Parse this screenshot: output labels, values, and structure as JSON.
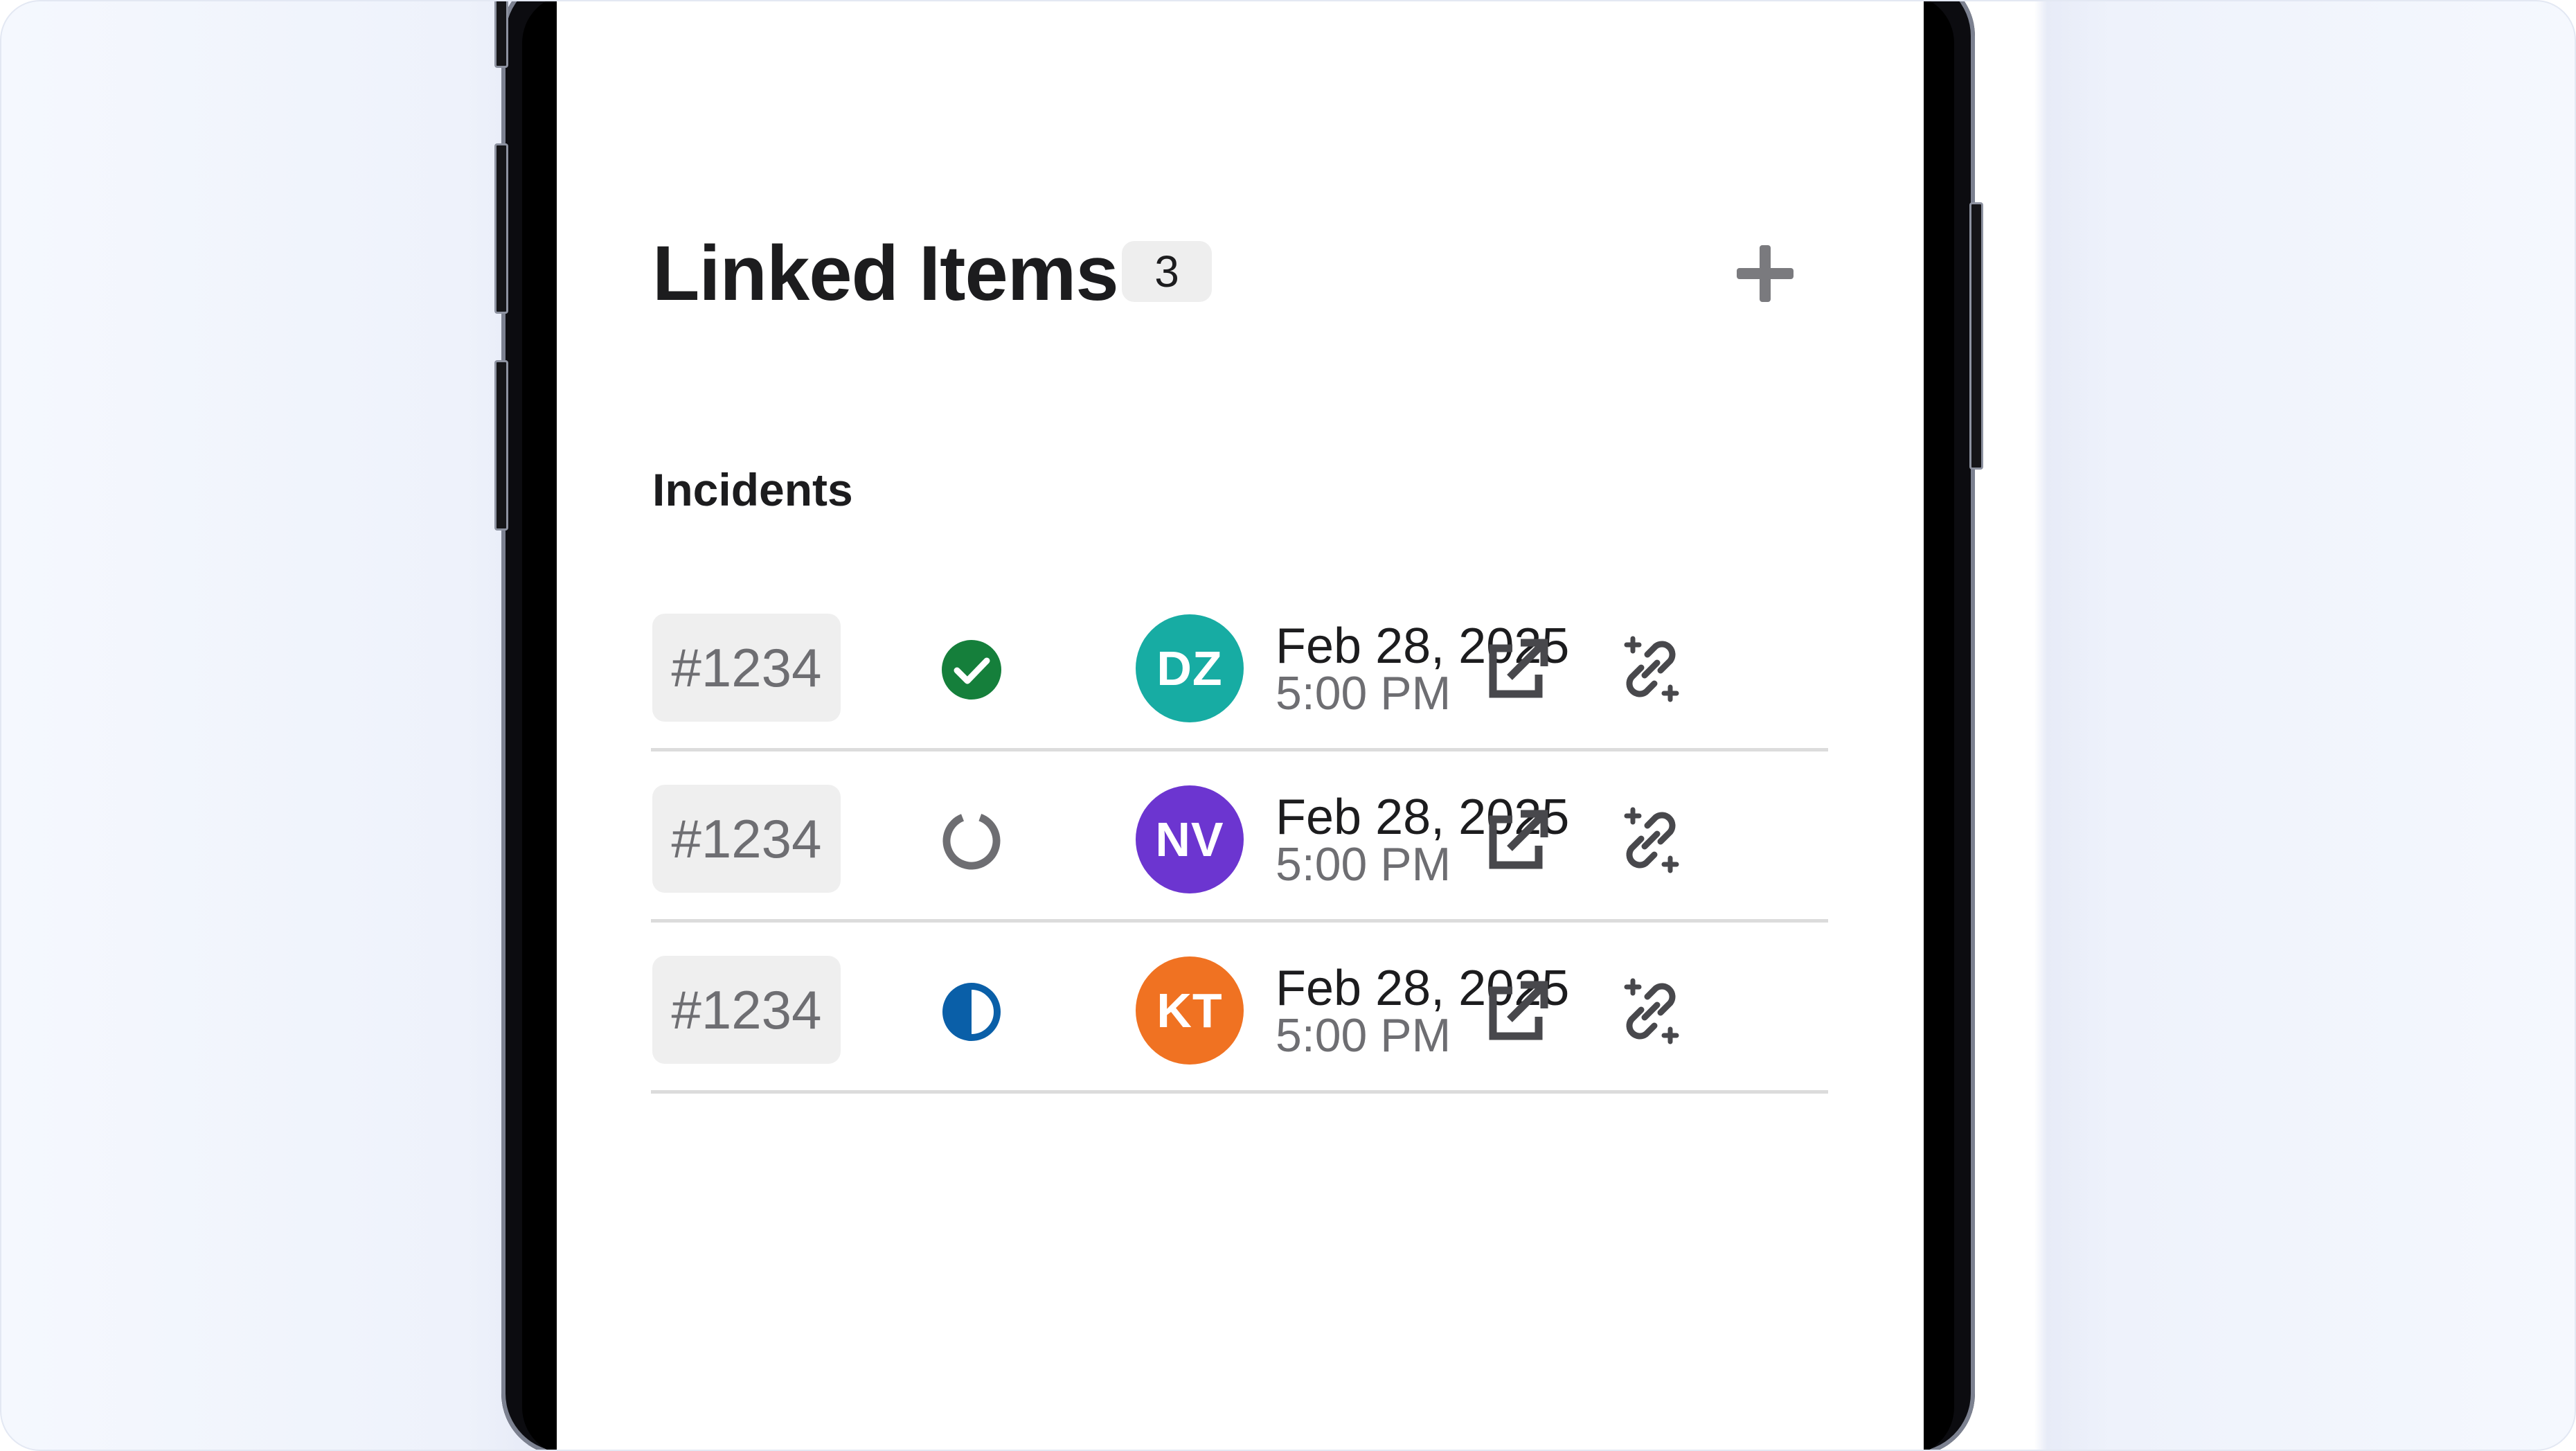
{
  "panel": {
    "title": "Linked Items",
    "count": "3",
    "add_icon": "plus-icon"
  },
  "section": {
    "label": "Incidents"
  },
  "colors": {
    "resolved": "#157f3b",
    "open": "#6e6e72",
    "in_progress": "#0a5fa8",
    "avatar_dz": "#17aca3",
    "avatar_nv": "#6c35d0",
    "avatar_kt": "#f07222"
  },
  "incidents": [
    {
      "id": "#1234",
      "status": "resolved",
      "status_icon": "check-circle-icon",
      "initials": "DZ",
      "avatar_color": "#17aca3",
      "date": "Feb 28, 2025",
      "time": "5:00 PM",
      "open_icon": "external-link-icon",
      "unlink_icon": "unlink-icon"
    },
    {
      "id": "#1234",
      "status": "open",
      "status_icon": "empty-circle-icon",
      "initials": "NV",
      "avatar_color": "#6c35d0",
      "date": "Feb 28, 2025",
      "time": "5:00 PM",
      "open_icon": "external-link-icon",
      "unlink_icon": "unlink-icon"
    },
    {
      "id": "#1234",
      "status": "in-progress",
      "status_icon": "half-circle-icon",
      "initials": "KT",
      "avatar_color": "#f07222",
      "date": "Feb 28, 2025",
      "time": "5:00 PM",
      "open_icon": "external-link-icon",
      "unlink_icon": "unlink-icon"
    }
  ]
}
